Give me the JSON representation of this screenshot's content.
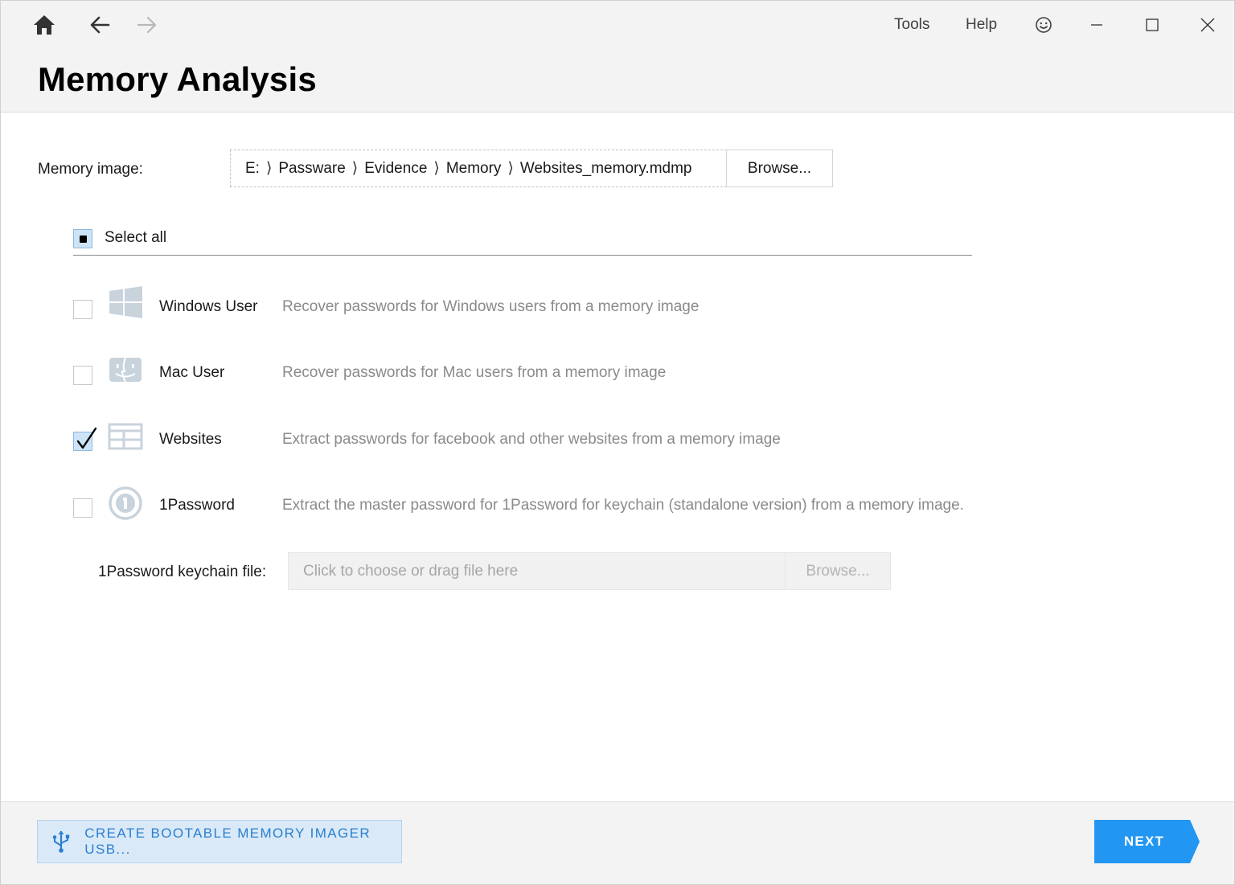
{
  "topbar": {
    "menu_tools": "Tools",
    "menu_help": "Help"
  },
  "page": {
    "title": "Memory Analysis"
  },
  "memory_image": {
    "label": "Memory image:",
    "path_segments": [
      "E:",
      "Passware",
      "Evidence",
      "Memory",
      "Websites_memory.mdmp"
    ],
    "separator": "⟩",
    "browse_label": "Browse..."
  },
  "select_all": {
    "label": "Select all",
    "state": "indeterminate"
  },
  "options": [
    {
      "name": "Windows User",
      "description": "Recover passwords for Windows users from a memory image",
      "checked": false,
      "icon": "windows-icon"
    },
    {
      "name": "Mac User",
      "description": "Recover passwords for Mac users from a memory image",
      "checked": false,
      "icon": "mac-finder-icon"
    },
    {
      "name": "Websites",
      "description": "Extract passwords for facebook and other websites from a memory image",
      "checked": true,
      "icon": "website-layout-icon"
    },
    {
      "name": "1Password",
      "description": "Extract the master password for 1Password for keychain (standalone version) from a memory image.",
      "checked": false,
      "icon": "onepassword-icon"
    }
  ],
  "keychain": {
    "label": "1Password keychain file:",
    "placeholder": "Click to choose or drag file here",
    "browse_label": "Browse..."
  },
  "footer": {
    "usb_button_label": "CREATE BOOTABLE MEMORY IMAGER USB...",
    "next_label": "NEXT"
  },
  "colors": {
    "accent": "#2196f3",
    "accent_text": "#2a7fd0",
    "header_bg": "#f3f3f3",
    "muted_text": "#8a8a8a",
    "icon_gray": "#c9d3dc"
  }
}
